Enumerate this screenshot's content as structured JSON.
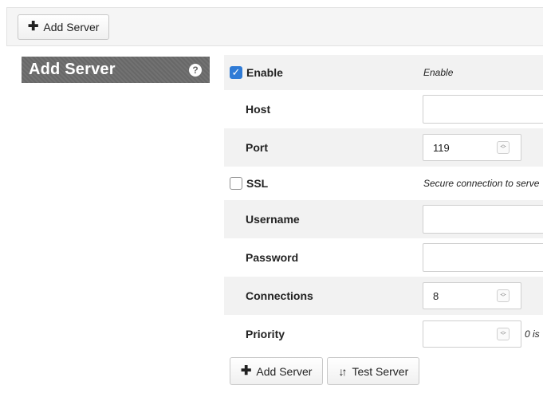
{
  "toolbar": {
    "add_server_label": "Add Server",
    "add_icon": "plus-icon"
  },
  "panel": {
    "title": "Add Server",
    "help_icon": "question-circle-icon"
  },
  "form": {
    "enable": {
      "label": "Enable",
      "checked": true,
      "description": "Enable"
    },
    "host": {
      "label": "Host",
      "value": ""
    },
    "port": {
      "label": "Port",
      "value": "119"
    },
    "ssl": {
      "label": "SSL",
      "checked": false,
      "description": "Secure connection to serve"
    },
    "username": {
      "label": "Username",
      "value": ""
    },
    "password": {
      "label": "Password",
      "value": ""
    },
    "connections": {
      "label": "Connections",
      "value": "8"
    },
    "priority": {
      "label": "Priority",
      "value": "",
      "note": "0 is"
    }
  },
  "buttons": {
    "add_server": "Add Server",
    "test_server": "Test Server"
  },
  "colors": {
    "accent": "#2f7bd6",
    "header_bg": "#6e6e6e",
    "row_shade": "#f2f2f2"
  }
}
